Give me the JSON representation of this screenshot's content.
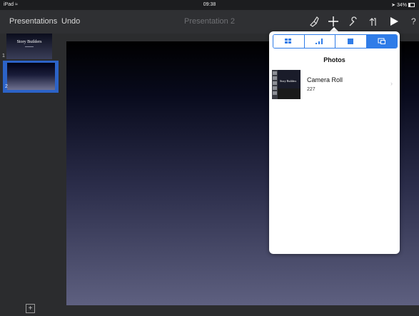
{
  "statusbar": {
    "device": "iPad",
    "time": "09:38",
    "battery": "34%"
  },
  "toolbar": {
    "presentations_label": "Presentations",
    "undo_label": "Undo",
    "document_title": "Presentation 2",
    "icons": [
      "paintbrush-icon",
      "add-icon",
      "wrench-icon",
      "share-icon",
      "play-icon",
      "help-icon"
    ],
    "help_label": "?"
  },
  "navigator": {
    "slides": [
      {
        "number": "1",
        "title": "Story Builders",
        "selected": false
      },
      {
        "number": "2",
        "selected": true
      }
    ],
    "add_label": "+"
  },
  "popover": {
    "tabs": [
      "tables-tab",
      "charts-tab",
      "shapes-tab",
      "media-tab"
    ],
    "active_tab": "media-tab",
    "title": "Photos",
    "albums": [
      {
        "name": "Camera Roll",
        "count": "227",
        "thumb_text": "Story Builders"
      }
    ],
    "accent_color": "#2f7ce8"
  }
}
